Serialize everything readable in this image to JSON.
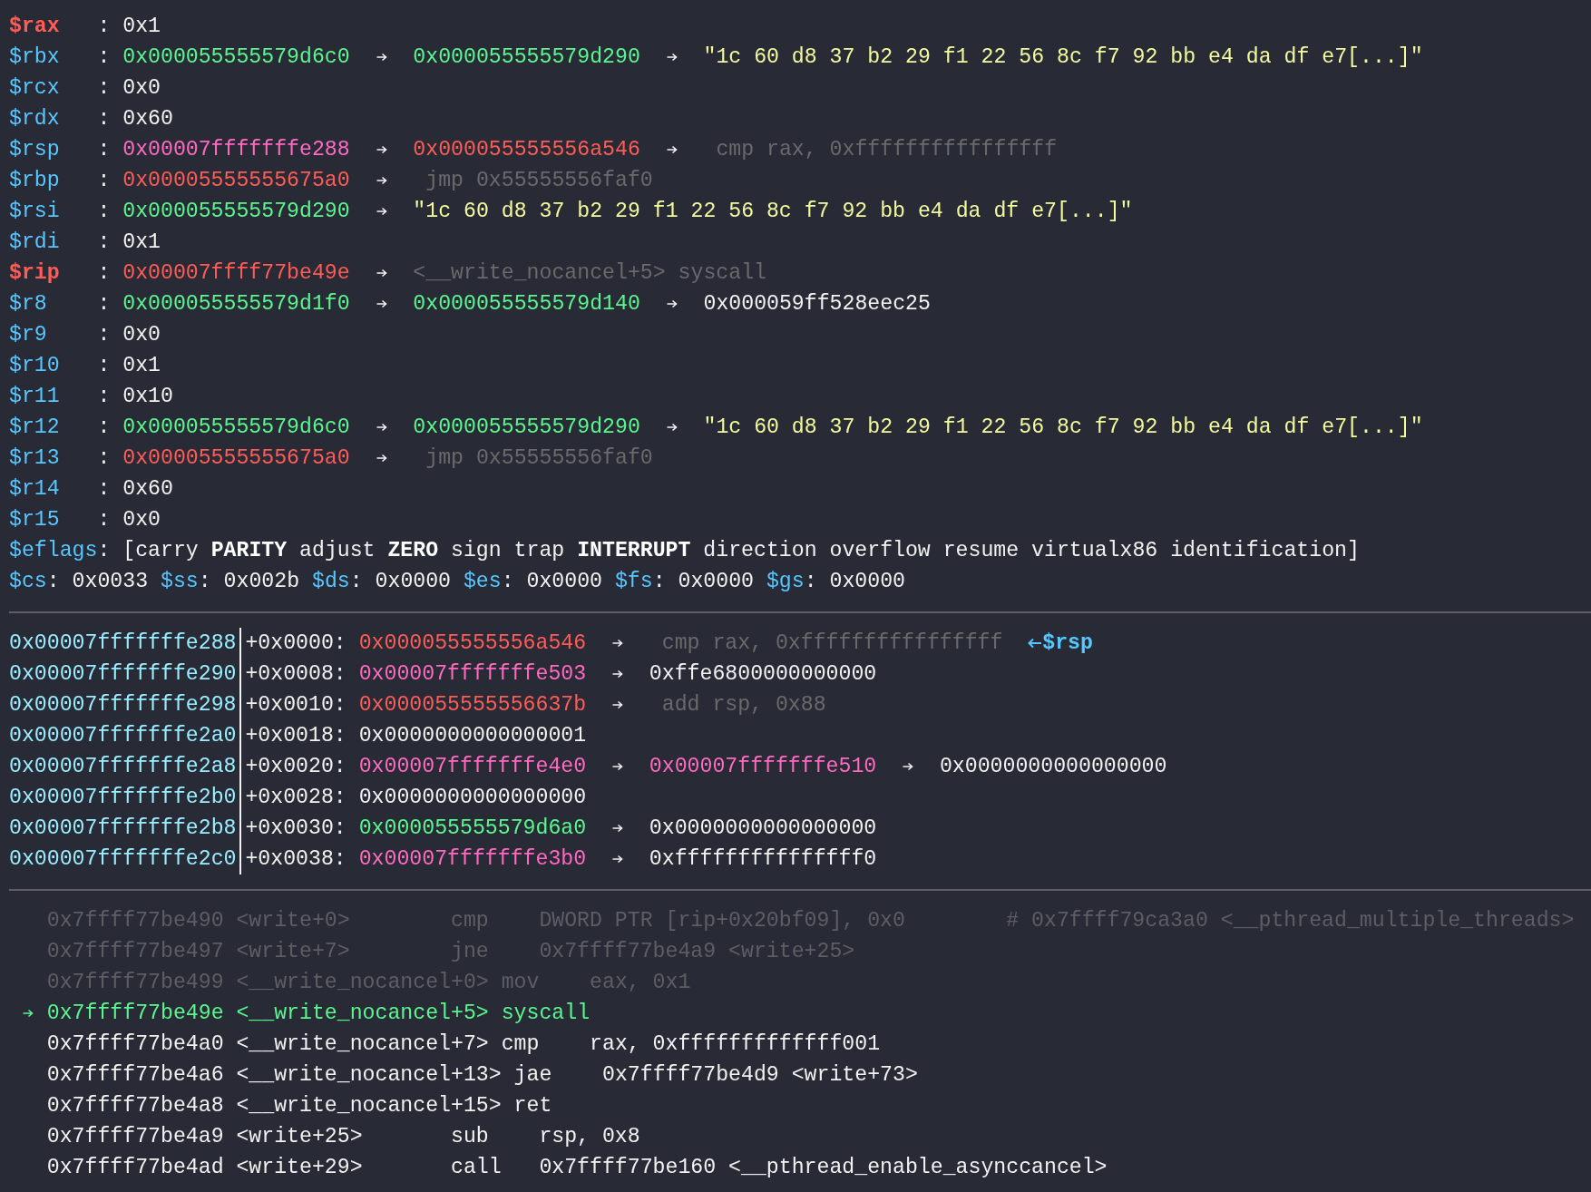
{
  "registers": [
    {
      "name": "$rax",
      "changed": true,
      "sep": ":",
      "chain": [
        {
          "kind": "value",
          "text": "0x1"
        }
      ]
    },
    {
      "name": "$rbx",
      "changed": false,
      "sep": ":",
      "chain": [
        {
          "kind": "heap",
          "text": "0x000055555579d6c0"
        },
        {
          "kind": "heap",
          "text": "0x000055555579d290"
        },
        {
          "kind": "string",
          "text": "\"1c 60 d8 37 b2 29 f1 22 56 8c f7 92 bb e4 da df e7[...]\""
        }
      ]
    },
    {
      "name": "$rcx",
      "changed": false,
      "sep": ":",
      "chain": [
        {
          "kind": "value",
          "text": "0x0"
        }
      ]
    },
    {
      "name": "$rdx",
      "changed": false,
      "sep": ":",
      "chain": [
        {
          "kind": "value",
          "text": "0x60"
        }
      ]
    },
    {
      "name": "$rsp",
      "changed": false,
      "sep": ":",
      "chain": [
        {
          "kind": "stack",
          "text": "0x00007fffffffe288"
        },
        {
          "kind": "code",
          "text": "0x000055555556a546"
        },
        {
          "kind": "insn",
          "text": "cmp rax, 0xffffffffffffffff"
        }
      ]
    },
    {
      "name": "$rbp",
      "changed": false,
      "sep": ":",
      "chain": [
        {
          "kind": "code",
          "text": "0x00005555555675a0"
        },
        {
          "kind": "insn",
          "text": "jmp 0x55555556faf0"
        }
      ]
    },
    {
      "name": "$rsi",
      "changed": false,
      "sep": ":",
      "chain": [
        {
          "kind": "heap",
          "text": "0x000055555579d290"
        },
        {
          "kind": "string",
          "text": "\"1c 60 d8 37 b2 29 f1 22 56 8c f7 92 bb e4 da df e7[...]\""
        }
      ]
    },
    {
      "name": "$rdi",
      "changed": false,
      "sep": ":",
      "chain": [
        {
          "kind": "value",
          "text": "0x1"
        }
      ]
    },
    {
      "name": "$rip",
      "changed": true,
      "sep": ":",
      "chain": [
        {
          "kind": "code",
          "text": "0x00007ffff77be49e"
        },
        {
          "kind": "symbol",
          "text": "<__write_nocancel+5> syscall"
        }
      ]
    },
    {
      "name": "$r8",
      "changed": false,
      "sep": ":",
      "chain": [
        {
          "kind": "heap",
          "text": "0x000055555579d1f0"
        },
        {
          "kind": "heap",
          "text": "0x000055555579d140"
        },
        {
          "kind": "value",
          "text": "0x000059ff528eec25"
        }
      ]
    },
    {
      "name": "$r9",
      "changed": false,
      "sep": ":",
      "chain": [
        {
          "kind": "value",
          "text": "0x0"
        }
      ]
    },
    {
      "name": "$r10",
      "changed": false,
      "sep": ":",
      "chain": [
        {
          "kind": "value",
          "text": "0x1"
        }
      ]
    },
    {
      "name": "$r11",
      "changed": false,
      "sep": ":",
      "chain": [
        {
          "kind": "value",
          "text": "0x10"
        }
      ]
    },
    {
      "name": "$r12",
      "changed": false,
      "sep": ":",
      "chain": [
        {
          "kind": "heap",
          "text": "0x000055555579d6c0"
        },
        {
          "kind": "heap",
          "text": "0x000055555579d290"
        },
        {
          "kind": "string",
          "text": "\"1c 60 d8 37 b2 29 f1 22 56 8c f7 92 bb e4 da df e7[...]\""
        }
      ]
    },
    {
      "name": "$r13",
      "changed": false,
      "sep": ":",
      "chain": [
        {
          "kind": "code",
          "text": "0x00005555555675a0"
        },
        {
          "kind": "insn",
          "text": "jmp 0x55555556faf0"
        }
      ]
    },
    {
      "name": "$r14",
      "changed": false,
      "sep": ":",
      "chain": [
        {
          "kind": "value",
          "text": "0x60"
        }
      ]
    },
    {
      "name": "$r15",
      "changed": false,
      "sep": ":",
      "chain": [
        {
          "kind": "value",
          "text": "0x0"
        }
      ]
    }
  ],
  "eflags": {
    "name": "$eflags",
    "sep": ":",
    "flags": [
      {
        "name": "[carry",
        "set": false
      },
      {
        "name": "PARITY",
        "set": true
      },
      {
        "name": "adjust",
        "set": false
      },
      {
        "name": "ZERO",
        "set": true
      },
      {
        "name": "sign",
        "set": false
      },
      {
        "name": "trap",
        "set": false
      },
      {
        "name": "INTERRUPT",
        "set": true
      },
      {
        "name": "direction",
        "set": false
      },
      {
        "name": "overflow",
        "set": false
      },
      {
        "name": "resume",
        "set": false
      },
      {
        "name": "virtualx86",
        "set": false
      },
      {
        "name": "identification]",
        "set": false
      }
    ]
  },
  "segments": [
    {
      "name": "$cs",
      "sep": ":",
      "value": "0x0033"
    },
    {
      "name": "$ss",
      "sep": ":",
      "value": "0x002b"
    },
    {
      "name": "$ds",
      "sep": ":",
      "value": "0x0000"
    },
    {
      "name": "$es",
      "sep": ":",
      "value": "0x0000"
    },
    {
      "name": "$fs",
      "sep": ":",
      "value": "0x0000"
    },
    {
      "name": "$gs",
      "sep": ":",
      "value": "0x0000"
    }
  ],
  "stack": [
    {
      "address": "0x00007fffffffe288",
      "offset": "+0x0000:",
      "chain": [
        {
          "kind": "code",
          "text": "0x000055555556a546"
        },
        {
          "kind": "insn",
          "text": "cmp rax, 0xffffffffffffffff"
        }
      ],
      "tag": "$rsp"
    },
    {
      "address": "0x00007fffffffe290",
      "offset": "+0x0008:",
      "chain": [
        {
          "kind": "stack",
          "text": "0x00007fffffffe503"
        },
        {
          "kind": "value",
          "text": "0xffe6800000000000"
        }
      ]
    },
    {
      "address": "0x00007fffffffe298",
      "offset": "+0x0010:",
      "chain": [
        {
          "kind": "code",
          "text": "0x000055555556637b"
        },
        {
          "kind": "insn",
          "text": "add rsp, 0x88"
        }
      ]
    },
    {
      "address": "0x00007fffffffe2a0",
      "offset": "+0x0018:",
      "chain": [
        {
          "kind": "value",
          "text": "0x0000000000000001"
        }
      ]
    },
    {
      "address": "0x00007fffffffe2a8",
      "offset": "+0x0020:",
      "chain": [
        {
          "kind": "stack",
          "text": "0x00007fffffffe4e0"
        },
        {
          "kind": "stack",
          "text": "0x00007fffffffe510"
        },
        {
          "kind": "value",
          "text": "0x0000000000000000"
        }
      ]
    },
    {
      "address": "0x00007fffffffe2b0",
      "offset": "+0x0028:",
      "chain": [
        {
          "kind": "value",
          "text": "0x0000000000000000"
        }
      ]
    },
    {
      "address": "0x00007fffffffe2b8",
      "offset": "+0x0030:",
      "chain": [
        {
          "kind": "heap",
          "text": "0x000055555579d6a0"
        },
        {
          "kind": "value",
          "text": "0x0000000000000000"
        }
      ]
    },
    {
      "address": "0x00007fffffffe2c0",
      "offset": "+0x0038:",
      "chain": [
        {
          "kind": "stack",
          "text": "0x00007fffffffe3b0"
        },
        {
          "kind": "value",
          "text": "0xfffffffffffffff0"
        }
      ]
    }
  ],
  "code": [
    {
      "executed": true,
      "current": false,
      "address": "0x7ffff77be490",
      "symbol": "<write+0>",
      "mnemonic": "cmp",
      "operands": "DWORD PTR [rip+0x20bf09], 0x0",
      "comment": "# 0x7ffff79ca3a0 <__pthread_multiple_threads>"
    },
    {
      "executed": true,
      "current": false,
      "address": "0x7ffff77be497",
      "symbol": "<write+7>",
      "mnemonic": "jne",
      "operands": "0x7ffff77be4a9 <write+25>"
    },
    {
      "executed": true,
      "current": false,
      "address": "0x7ffff77be499",
      "symbol": "<__write_nocancel+0>",
      "mnemonic": "mov",
      "operands": "eax, 0x1"
    },
    {
      "executed": false,
      "current": true,
      "address": "0x7ffff77be49e",
      "symbol": "<__write_nocancel+5>",
      "mnemonic": "syscall"
    },
    {
      "executed": false,
      "current": false,
      "address": "0x7ffff77be4a0",
      "symbol": "<__write_nocancel+7>",
      "mnemonic": "cmp",
      "operands": "rax, 0xfffffffffffff001"
    },
    {
      "executed": false,
      "current": false,
      "address": "0x7ffff77be4a6",
      "symbol": "<__write_nocancel+13>",
      "mnemonic": "jae",
      "operands": "0x7ffff77be4d9 <write+73>"
    },
    {
      "executed": false,
      "current": false,
      "address": "0x7ffff77be4a8",
      "symbol": "<__write_nocancel+15>",
      "mnemonic": "ret"
    },
    {
      "executed": false,
      "current": false,
      "address": "0x7ffff77be4a9",
      "symbol": "<write+25>",
      "mnemonic": "sub",
      "operands": "rsp, 0x8"
    },
    {
      "executed": false,
      "current": false,
      "address": "0x7ffff77be4ad",
      "symbol": "<write+29>",
      "mnemonic": "call",
      "operands": "0x7ffff77be160 <__pthread_enable_asynccancel>"
    }
  ]
}
